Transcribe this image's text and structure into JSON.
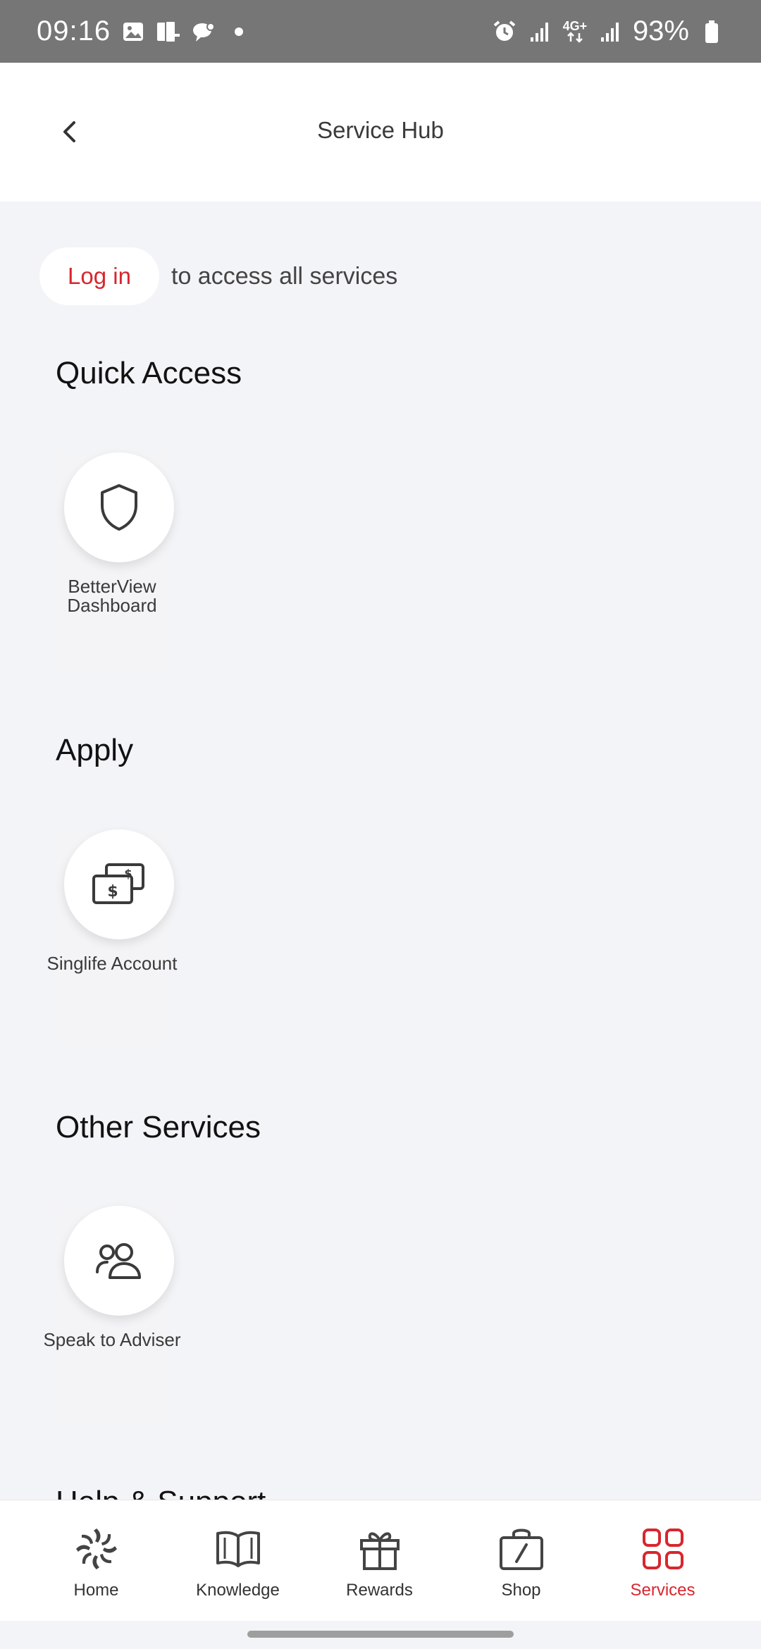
{
  "status_bar": {
    "time": "09:16",
    "network": "4G+",
    "battery": "93%"
  },
  "header": {
    "title": "Service Hub"
  },
  "login": {
    "button_label": "Log in",
    "message": "to access all services"
  },
  "sections": {
    "quick_access": {
      "title": "Quick Access",
      "items": [
        {
          "label": "BetterView Dashboard",
          "icon": "shield-icon"
        }
      ]
    },
    "apply": {
      "title": "Apply",
      "items": [
        {
          "label": "Singlife Account",
          "icon": "money-transfer-icon"
        }
      ]
    },
    "other_services": {
      "title": "Other Services",
      "items": [
        {
          "label": "Speak to Adviser",
          "icon": "people-icon"
        }
      ]
    },
    "help_support": {
      "title": "Help & Support"
    }
  },
  "bottom_nav": {
    "items": [
      {
        "label": "Home",
        "icon": "swirl-logo-icon"
      },
      {
        "label": "Knowledge",
        "icon": "book-icon"
      },
      {
        "label": "Rewards",
        "icon": "gift-icon"
      },
      {
        "label": "Shop",
        "icon": "shopping-bag-icon"
      },
      {
        "label": "Services",
        "icon": "grid-icon",
        "active": true
      }
    ]
  },
  "colors": {
    "accent": "#d8262e",
    "background": "#f3f4f7",
    "status_bar": "#767676"
  }
}
